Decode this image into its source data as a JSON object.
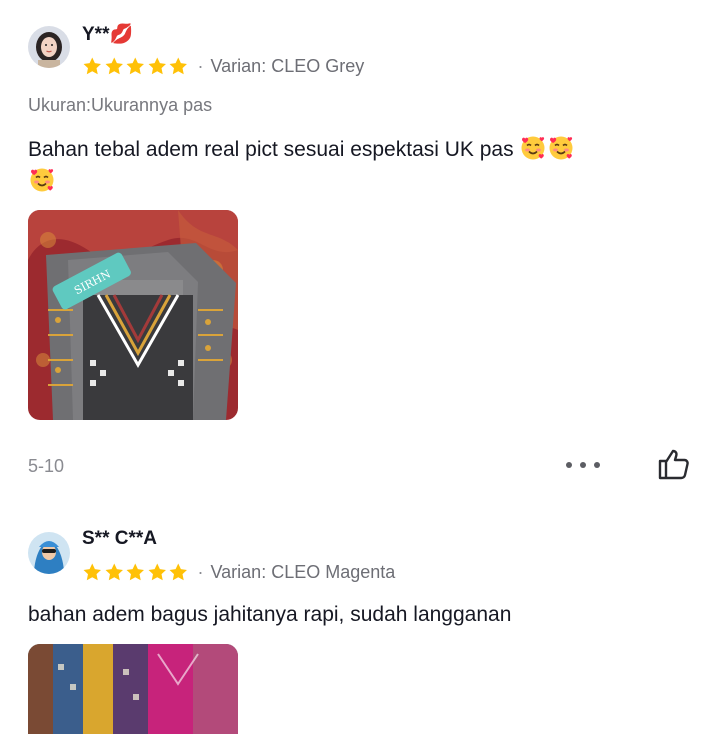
{
  "reviews": [
    {
      "username": "Y**💋",
      "rating": 5,
      "variant": "Varian: CLEO Grey",
      "size_note": "Ukuran:Ukurannya pas",
      "text": "Bahan tebal adem real pict sesuai espektasi UK pas",
      "emoji": [
        "smiling-face-with-hearts-icon",
        "smiling-face-with-hearts-icon",
        "smiling-face-with-hearts-icon"
      ],
      "date": "5-10",
      "photo_label": "SIRHN"
    },
    {
      "username": "S** C**A",
      "rating": 5,
      "variant": "Varian: CLEO Magenta",
      "text": "bahan adem bagus jahitanya rapi, sudah langganan"
    }
  ],
  "colors": {
    "star": "#ffc107",
    "text_primary": "#161823",
    "text_secondary": "#77787e"
  },
  "icons": {
    "more": "more-dots-icon",
    "like": "thumbs-up-icon"
  }
}
